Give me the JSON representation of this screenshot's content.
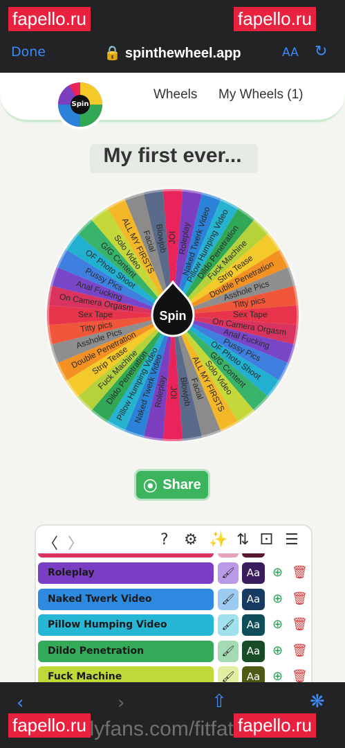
{
  "browser": {
    "done_label": "Done",
    "url": "spinthewheel.app",
    "text_size_label": "AA"
  },
  "header": {
    "logo_label": "Spin",
    "nav_wheels": "Wheels",
    "nav_my_wheels": "My Wheels (1)"
  },
  "wheel": {
    "title": "My first ever...",
    "hub_label": "Spin",
    "segments": [
      {
        "label": "JOI",
        "color": "#e8245b"
      },
      {
        "label": "Roleplay",
        "color": "#7b3fbf"
      },
      {
        "label": "Naked Twerk Video",
        "color": "#2a83d8"
      },
      {
        "label": "Pillow Humping Video",
        "color": "#25b3cf"
      },
      {
        "label": "Dildo Penetration",
        "color": "#31a856"
      },
      {
        "label": "Fuck Machine",
        "color": "#b6d23a"
      },
      {
        "label": "Strip Tease",
        "color": "#f4c92a"
      },
      {
        "label": "Double Penetration",
        "color": "#f39222"
      },
      {
        "label": "Asshole Pics",
        "color": "#8e8e8e"
      },
      {
        "label": "Titty pics",
        "color": "#f0573a"
      },
      {
        "label": "Sex Tape",
        "color": "#e8344a"
      },
      {
        "label": "On Camera Orgasm",
        "color": "#d8345f"
      },
      {
        "label": "Anal Fucking",
        "color": "#7a46c8"
      },
      {
        "label": "Pussy Pics",
        "color": "#3f7fe0"
      },
      {
        "label": "OF Photo Shoot",
        "color": "#22b0d0"
      },
      {
        "label": "G/G Content",
        "color": "#38b36a"
      },
      {
        "label": "Solo Video",
        "color": "#c4d83a"
      },
      {
        "label": "ALL MY FIRSTS",
        "color": "#f4b728"
      },
      {
        "label": "Facial",
        "color": "#8b8b8b"
      },
      {
        "label": "Blowjob",
        "color": "#5a6a8a"
      }
    ]
  },
  "share_label": "Share",
  "editor": {
    "entries": [
      {
        "label": "Roleplay",
        "color": "#7a3ec4",
        "paint_color": "#b99ae6",
        "font_color": "#3a1d5c"
      },
      {
        "label": "Naked Twerk Video",
        "color": "#2d8ae0",
        "paint_color": "#9ccaf1",
        "font_color": "#173a63"
      },
      {
        "label": "Pillow Humping Video",
        "color": "#26b7d4",
        "paint_color": "#a0e1ed",
        "font_color": "#0f4d5b"
      },
      {
        "label": "Dildo Penetration",
        "color": "#33ab58",
        "paint_color": "#a4dbb4",
        "font_color": "#164d27"
      },
      {
        "label": "Fuck Machine",
        "color": "#c0d83a",
        "paint_color": "#e3eea3",
        "font_color": "#4c5a13"
      }
    ],
    "font_button_label": "Aa"
  },
  "watermarks": {
    "site": "fapello.ru",
    "footer_url": "onlyfans.com/fitfathans"
  },
  "colors": {
    "accent": "#3b8cf7",
    "share": "#3cb45e",
    "chrome": "#232325",
    "watermark": "#e8213f"
  },
  "icons": [
    "lock-icon",
    "refresh-icon",
    "help-icon",
    "settings-icon",
    "sparkle-icon",
    "sort-icon",
    "dice-icon",
    "list-icon",
    "paint-bucket-icon",
    "duplicate-icon",
    "trash-icon",
    "back-arrow-icon",
    "forward-arrow-icon",
    "share-icon",
    "compass-icon",
    "share-nodes-icon"
  ]
}
